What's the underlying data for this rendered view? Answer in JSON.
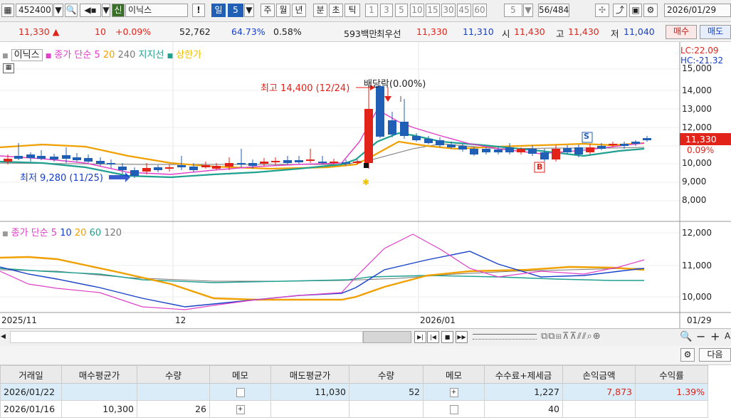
{
  "toolbar": {
    "code": "452400",
    "badge": "신",
    "name": "이닉스",
    "excl": "!",
    "day": "일",
    "period": "5",
    "week": "주",
    "month": "월",
    "year": "년",
    "minute": "분",
    "sec": "초",
    "tick": "틱",
    "nums": [
      "1",
      "3",
      "5",
      "10",
      "15",
      "30",
      "45",
      "60"
    ],
    "count_sel": "5",
    "count": "56/484",
    "date": "2026/01/29"
  },
  "price": {
    "current": "11,330 ▲",
    "change": "10",
    "rate": "+0.09%",
    "volume": "52,762",
    "vol_rate": "64.73%",
    "turnover": "0.58%",
    "amount": "593백만",
    "bid_label": "최우선",
    "ask": "11,330",
    "bid": "11,310",
    "open_label": "시",
    "open": "11,430",
    "high_label": "고",
    "high": "11,430",
    "low_label": "저",
    "low": "11,040",
    "buy": "매수",
    "sell": "매도"
  },
  "legend_top": {
    "name": "이닉스",
    "ma": "종가 단순 5",
    "p20": "20",
    "p240": "240",
    "support": "지지선",
    "limit": "상한가"
  },
  "legend_bottom": {
    "ma": "종가 단순 5",
    "p10": "10",
    "p20": "20",
    "p60": "60",
    "p120": "120"
  },
  "annotations": {
    "high": "최고 14,400 (12/24)",
    "low": "최저 9,280 (11/25)",
    "dividend": "배당락(0.00%)",
    "lc": "LC:22.09",
    "hc": "HC:-21.32",
    "cur_price": "11,330",
    "cur_pct": "0.09%",
    "s_marker": "S",
    "b_marker": "B"
  },
  "axis_top": [
    "15,000",
    "14,000",
    "13,000",
    "12,000",
    "10,000",
    "9,000",
    "8,000"
  ],
  "axis_bottom": [
    "12,000",
    "11,000",
    "10,000"
  ],
  "xaxis": {
    "left": "2025/11",
    "mid": "12",
    "jan": "2026/01",
    "right": "01/29"
  },
  "options": {
    "next": "다음"
  },
  "table": {
    "headers": [
      "거래일",
      "매수평균가",
      "수량",
      "메모",
      "매도평균가",
      "수량",
      "메모",
      "수수료+제세금",
      "손익금액",
      "수익률"
    ],
    "rows": [
      {
        "date": "2026/01/22",
        "buy_avg": "",
        "buy_qty": "",
        "sell_avg": "11,030",
        "sell_qty": "52",
        "fee": "1,227",
        "pnl": "7,873",
        "rate": "1.39%"
      },
      {
        "date": "2026/01/16",
        "buy_avg": "10,300",
        "buy_qty": "26",
        "sell_avg": "",
        "sell_qty": "",
        "fee": "40",
        "pnl": "",
        "rate": ""
      }
    ]
  },
  "colors": {
    "up": "#e2231a",
    "down": "#1f5fb5",
    "ma5": "#e040c8",
    "ma20": "#f0a000",
    "ma60": "#1fa090"
  }
}
